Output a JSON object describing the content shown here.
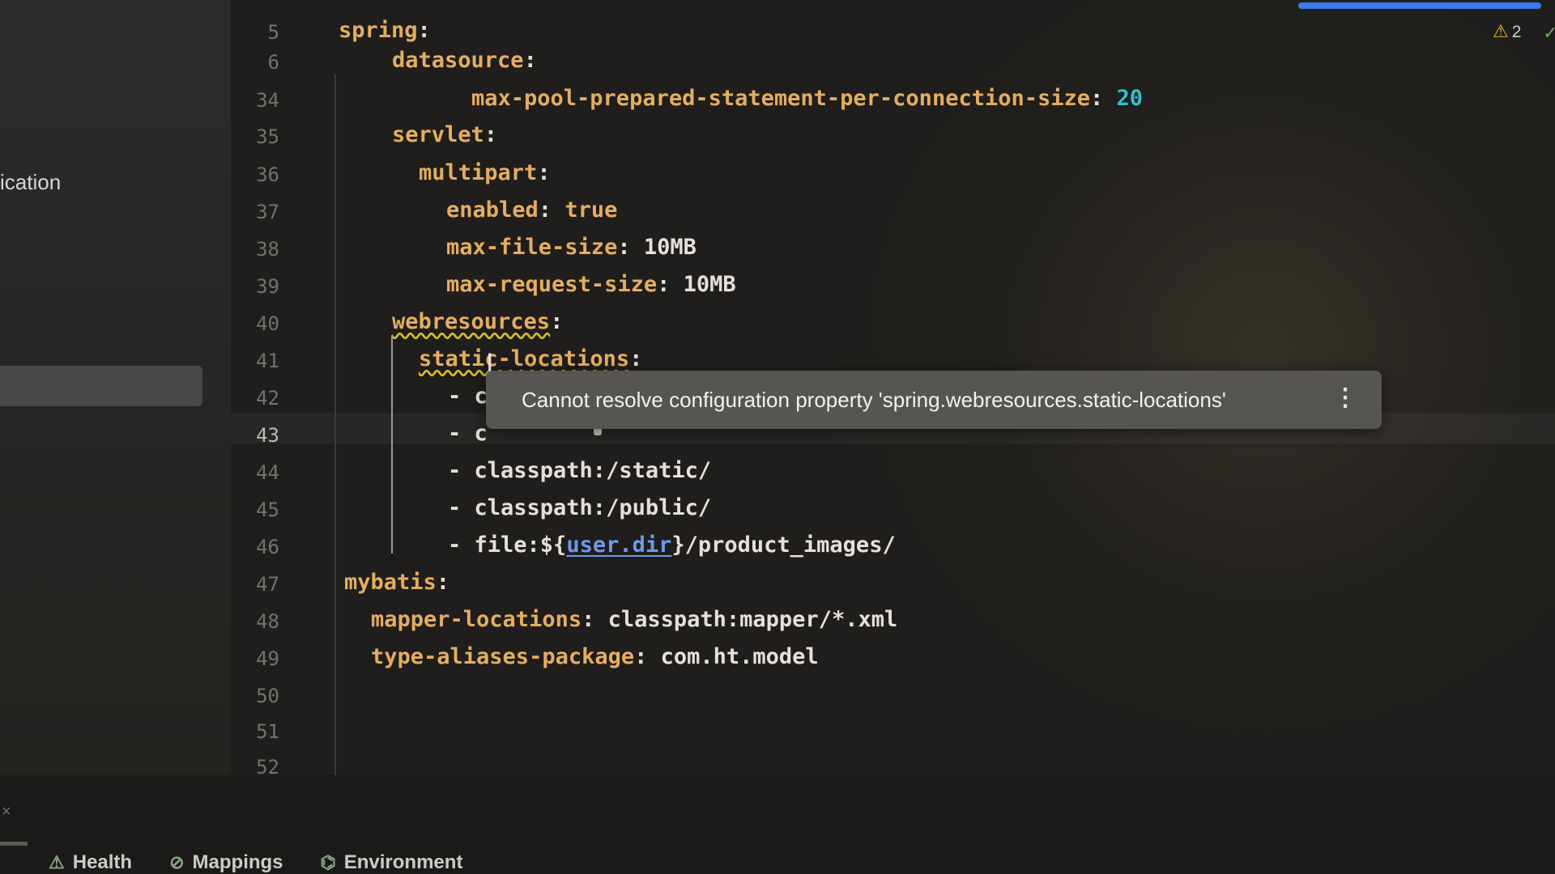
{
  "sidebar": {
    "partial_text": "ication"
  },
  "editor": {
    "warning_count": "2",
    "lines": [
      {
        "num": "5",
        "parts": [
          {
            "t": "spring",
            "c": "key"
          },
          {
            "t": ":",
            "c": "val"
          }
        ]
      },
      {
        "num": "6",
        "parts": [
          {
            "t": "datasource",
            "c": "key"
          },
          {
            "t": ":",
            "c": "val"
          }
        ]
      },
      {
        "num": "34",
        "parts": [
          {
            "t": "max-pool-prepared-statement-per-connection-size",
            "c": "key"
          },
          {
            "t": ": ",
            "c": "val"
          },
          {
            "t": "20",
            "c": "num"
          }
        ]
      },
      {
        "num": "35",
        "parts": [
          {
            "t": "servlet",
            "c": "key"
          },
          {
            "t": ":",
            "c": "val"
          }
        ]
      },
      {
        "num": "36",
        "parts": [
          {
            "t": "multipart",
            "c": "key"
          },
          {
            "t": ":",
            "c": "val"
          }
        ]
      },
      {
        "num": "37",
        "parts": [
          {
            "t": "enabled",
            "c": "key"
          },
          {
            "t": ": ",
            "c": "val"
          },
          {
            "t": "true",
            "c": "key"
          }
        ]
      },
      {
        "num": "38",
        "parts": [
          {
            "t": "max-file-size",
            "c": "key"
          },
          {
            "t": ": 10MB",
            "c": "val"
          }
        ]
      },
      {
        "num": "39",
        "parts": [
          {
            "t": "max-request-size",
            "c": "key"
          },
          {
            "t": ": 10MB",
            "c": "val"
          }
        ]
      },
      {
        "num": "40",
        "parts": [
          {
            "t": "webresources",
            "c": "warnkey"
          },
          {
            "t": ":",
            "c": "val"
          }
        ]
      },
      {
        "num": "41",
        "parts": [
          {
            "t": "static-locations",
            "c": "warnkey"
          },
          {
            "t": ":",
            "c": "val"
          }
        ]
      },
      {
        "num": "42",
        "parts": [
          {
            "t": "- c",
            "c": "val"
          }
        ]
      },
      {
        "num": "43",
        "parts": [
          {
            "t": "- c",
            "c": "val"
          }
        ]
      },
      {
        "num": "44",
        "parts": [
          {
            "t": "- classpath:/static/",
            "c": "val"
          }
        ]
      },
      {
        "num": "45",
        "parts": [
          {
            "t": "- classpath:/public/",
            "c": "val"
          }
        ]
      },
      {
        "num": "46",
        "parts": [
          {
            "t": "- file:${",
            "c": "val"
          },
          {
            "t": "user.dir",
            "c": "ref"
          },
          {
            "t": "}/product_images/",
            "c": "val"
          }
        ]
      },
      {
        "num": "47",
        "parts": [
          {
            "t": "mybatis",
            "c": "key"
          },
          {
            "t": ":",
            "c": "val"
          }
        ]
      },
      {
        "num": "48",
        "parts": [
          {
            "t": "mapper-locations",
            "c": "key"
          },
          {
            "t": ": classpath:mapper/*.xml",
            "c": "val"
          }
        ]
      },
      {
        "num": "49",
        "parts": [
          {
            "t": "type-aliases-package",
            "c": "key"
          },
          {
            "t": ": com.ht.model",
            "c": "val"
          }
        ]
      },
      {
        "num": "50",
        "parts": []
      },
      {
        "num": "51",
        "parts": []
      },
      {
        "num": "52",
        "parts": []
      }
    ],
    "current_line": "43"
  },
  "tooltip": {
    "message": "Cannot resolve configuration property 'spring.webresources.static-locations'",
    "more_icon": "more-vertical-icon"
  },
  "bottom_tabs": [
    {
      "icon": "health-icon",
      "label": "Health"
    },
    {
      "icon": "mappings-icon",
      "label": "Mappings"
    },
    {
      "icon": "environment-icon",
      "label": "Environment"
    }
  ],
  "colors": {
    "key": "#e5ad62",
    "number": "#34bdd0",
    "text": "#e5e1d8",
    "reference": "#6e9be8",
    "progress": "#3a79e8",
    "bulb": "#f2c81b"
  }
}
